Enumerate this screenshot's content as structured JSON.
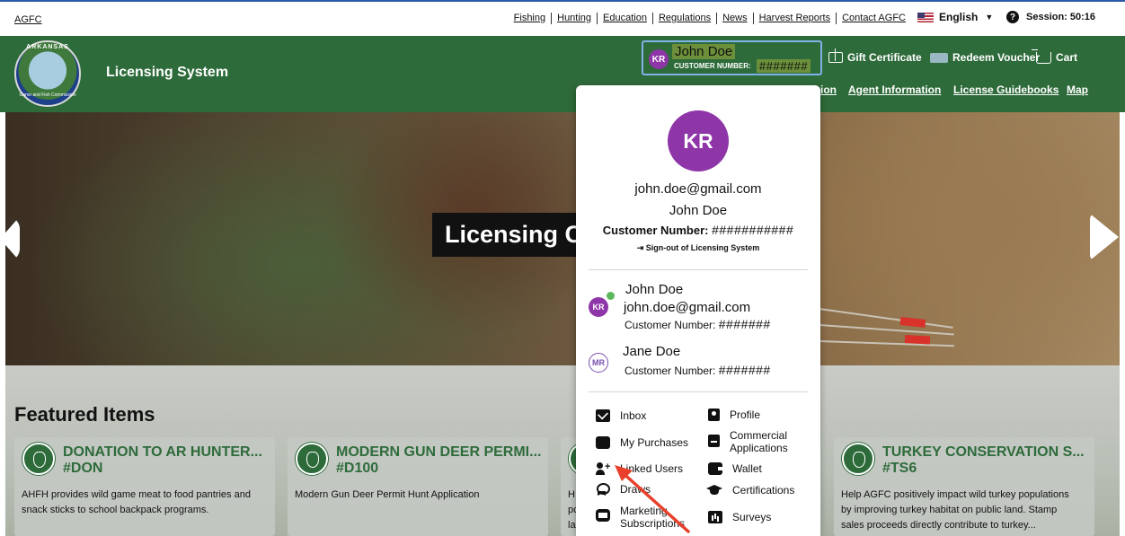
{
  "topbar": {
    "agfc_link": "AGFC",
    "links": [
      "Fishing",
      "Hunting",
      "Education",
      "Regulations",
      "News",
      "Harvest Reports",
      "Contact AGFC"
    ],
    "language": "English",
    "session": "Session: 50:16"
  },
  "header": {
    "logo_top": "ARKANSAS",
    "logo_bottom": "Game and Fish Commission",
    "site_title": "Licensing System",
    "account": {
      "initials": "KR",
      "name": "John Doe",
      "customer_number_label": "CUSTOMER NUMBER:",
      "customer_number": "#######"
    },
    "gift_certificate": "Gift Certificate",
    "redeem_voucher": "Redeem Voucher",
    "cart": "Cart",
    "nav_partial": "ion",
    "nav": [
      "Agent Information",
      "License Guidebooks",
      "Map"
    ]
  },
  "hero": {
    "title": "Licensing C"
  },
  "featured": {
    "heading": "Featured Items",
    "cards": [
      {
        "title": "DONATION TO AR HUNTER...",
        "code": "#DON",
        "desc_lines": [
          "AHFH provides wild game meat to food pantries and",
          "snack sticks to school backpack programs."
        ]
      },
      {
        "title": "MODERN GUN DEER PERMI...",
        "code": "#D100",
        "desc_lines": [
          "Modern Gun Deer Permit Hunt Application"
        ]
      },
      {
        "title": "",
        "code": "",
        "desc_lines": [
          "H",
          "pc",
          "la"
        ]
      },
      {
        "title": "TURKEY CONSERVATION S...",
        "code": "#TS6",
        "desc_lines": [
          "Help AGFC positively impact wild turkey populations",
          "by improving turkey habitat on public land. Stamp",
          "sales proceeds directly contribute to turkey..."
        ]
      }
    ]
  },
  "account_panel": {
    "initials": "KR",
    "email": "john.doe@gmail.com",
    "name": "John Doe",
    "customer_number_label": "Customer Number:",
    "customer_number": "###########",
    "sign_out": "Sign-out of Licensing System",
    "users": [
      {
        "initials": "KR",
        "name": "John Doe",
        "email": "john.doe@gmail.com",
        "cn_label": "Customer Number:",
        "cn": "#######"
      },
      {
        "initials": "MR",
        "name": "Jane Doe",
        "cn_label": "Customer Number:",
        "cn": "#######"
      }
    ],
    "menu": {
      "inbox": "Inbox",
      "purchases": "My Purchases",
      "linked_users": "Linked Users",
      "draws": "Draws",
      "marketing_1": "Marketing",
      "marketing_2": "Subscriptions",
      "profile": "Profile",
      "commercial_1": "Commercial",
      "commercial_2": "Applications",
      "wallet": "Wallet",
      "certifications": "Certifications",
      "surveys": "Surveys"
    }
  },
  "colors": {
    "header_green": "#2e6b3a",
    "avatar_purple": "#8e35a8",
    "annotation_red": "#e8402a"
  }
}
